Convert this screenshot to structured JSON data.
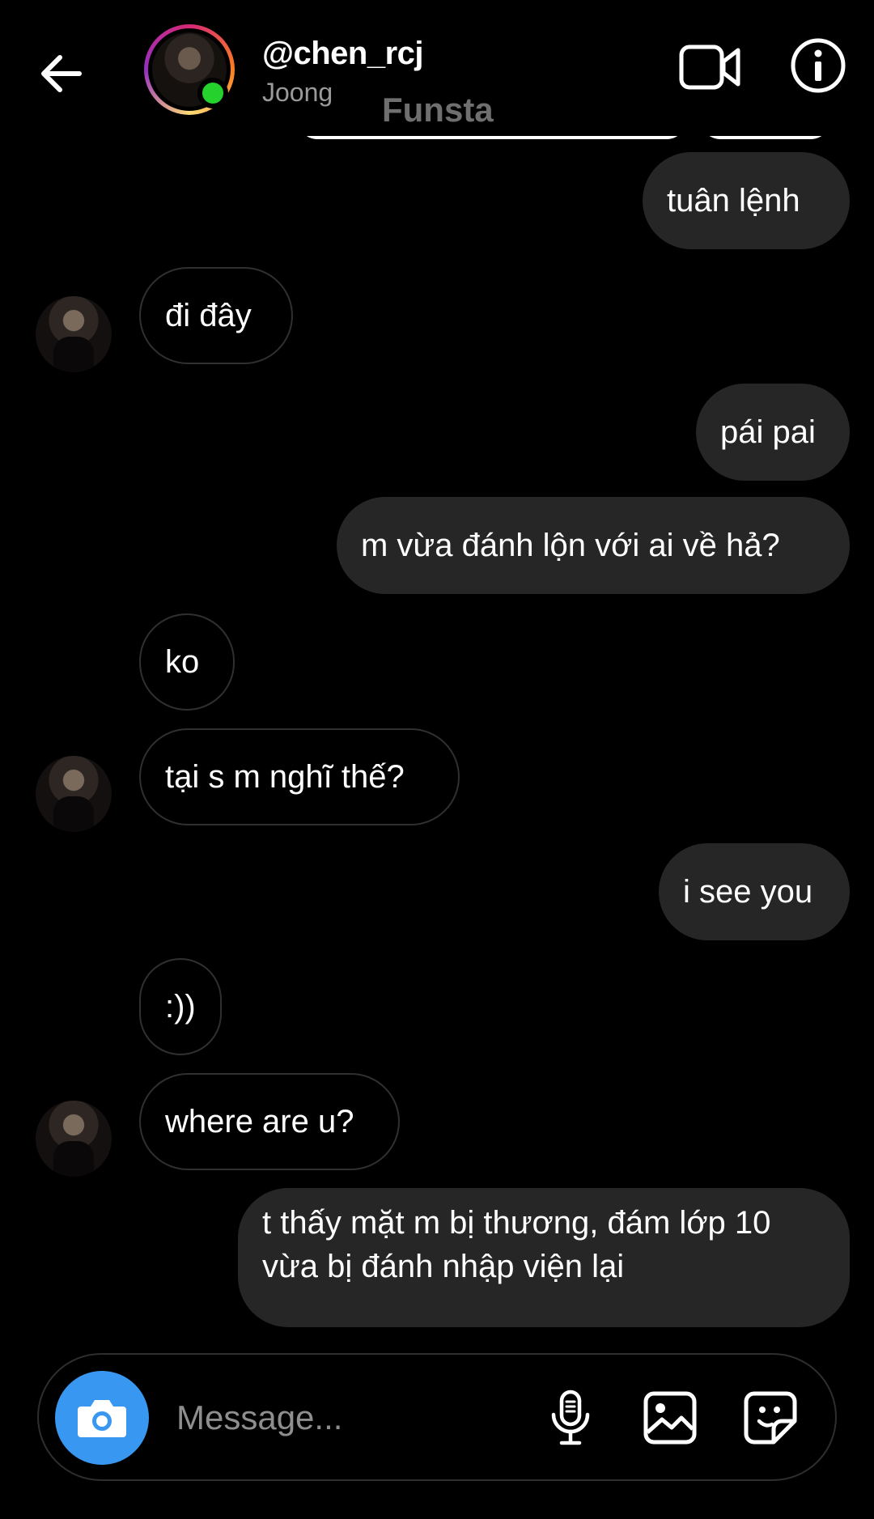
{
  "header": {
    "username": "@chen_rcj",
    "display_name": "Joong",
    "overlay_text": "Funsta",
    "icons": {
      "back": "arrow-left-icon",
      "video": "video-camera-icon",
      "info": "info-icon"
    },
    "online_color": "#25d12d"
  },
  "messages": [
    {
      "side": "out",
      "text": "tuân lệnh"
    },
    {
      "side": "in",
      "text": "đi đây",
      "avatar": true
    },
    {
      "side": "out",
      "text": "pái pai"
    },
    {
      "side": "out",
      "text": "m vừa đánh lộn với ai về hả?"
    },
    {
      "side": "in",
      "text": "ko"
    },
    {
      "side": "in",
      "text": "tại s m nghĩ thế?",
      "avatar": true
    },
    {
      "side": "out",
      "text": "i see you"
    },
    {
      "side": "in",
      "text": ":))"
    },
    {
      "side": "in",
      "text": "where are u?",
      "avatar": true
    },
    {
      "side": "out",
      "lines": [
        "t thấy mặt m bị thương, đám lớp 10",
        "vừa bị đánh nhập viện lại"
      ]
    }
  ],
  "composer": {
    "placeholder": "Message...",
    "icons": {
      "camera": "camera-icon",
      "mic": "microphone-icon",
      "gallery": "image-icon",
      "sticker": "sticker-icon"
    },
    "camera_color": "#3897f0"
  },
  "colors": {
    "background": "#000000",
    "outgoing_bubble": "#262626",
    "incoming_border": "#303030"
  }
}
